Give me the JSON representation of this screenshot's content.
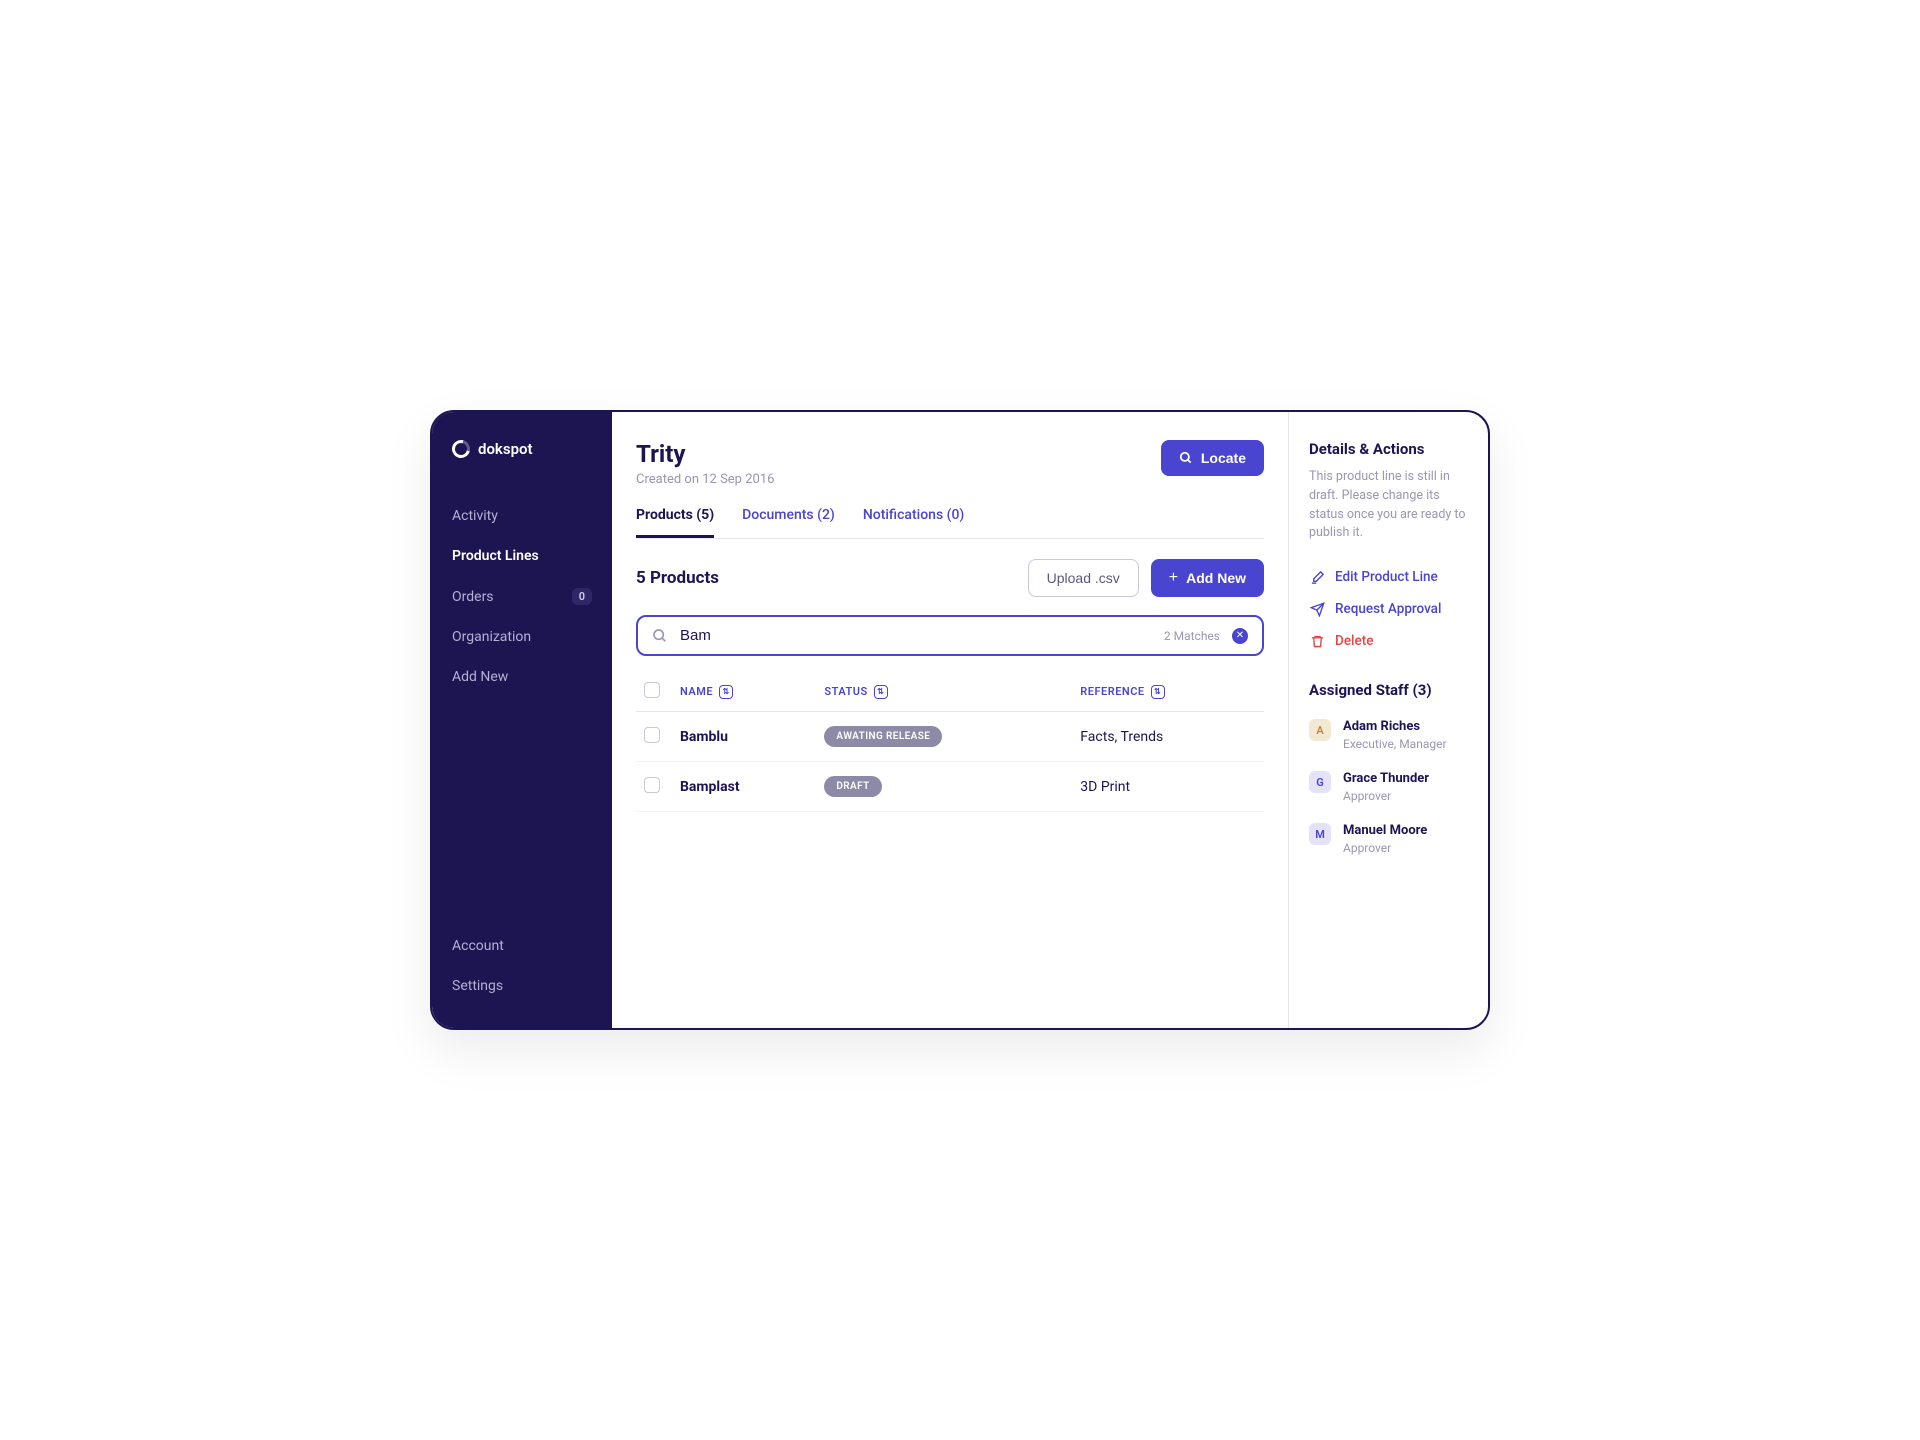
{
  "brand": "dokspot",
  "sidebar": {
    "items": [
      {
        "label": "Activity"
      },
      {
        "label": "Product Lines"
      },
      {
        "label": "Orders",
        "badge": "0"
      },
      {
        "label": "Organization"
      },
      {
        "label": "Add New"
      }
    ],
    "footer": [
      {
        "label": "Account"
      },
      {
        "label": "Settings"
      }
    ]
  },
  "header": {
    "title": "Trity",
    "subtitle": "Created on 12 Sep 2016",
    "locate_label": "Locate"
  },
  "tabs": [
    {
      "label": "Products (5)"
    },
    {
      "label": "Documents (2)"
    },
    {
      "label": "Notifications (0)"
    }
  ],
  "section": {
    "title": "5 Products",
    "upload_label": "Upload .csv",
    "add_label": "Add New"
  },
  "search": {
    "value": "Bam",
    "matches": "2 Matches"
  },
  "columns": {
    "name": "NAME",
    "status": "STATUS",
    "reference": "REFERENCE"
  },
  "rows": [
    {
      "name": "Bamblu",
      "status": "AWATING RELEASE",
      "reference": "Facts, Trends"
    },
    {
      "name": "Bamplast",
      "status": "DRAFT",
      "reference": "3D Print"
    }
  ],
  "panel": {
    "details_title": "Details & Actions",
    "details_text": "This product line is still in draft. Please change its status once you are ready to publish it.",
    "edit": "Edit Product Line",
    "request": "Request Approval",
    "delete": "Delete",
    "staff_title": "Assigned Staff (3)",
    "staff": [
      {
        "initial": "A",
        "name": "Adam Riches",
        "role": "Executive, Manager",
        "cls": "a"
      },
      {
        "initial": "G",
        "name": "Grace Thunder",
        "role": "Approver",
        "cls": "g"
      },
      {
        "initial": "M",
        "name": "Manuel Moore",
        "role": "Approver",
        "cls": "m"
      }
    ]
  }
}
